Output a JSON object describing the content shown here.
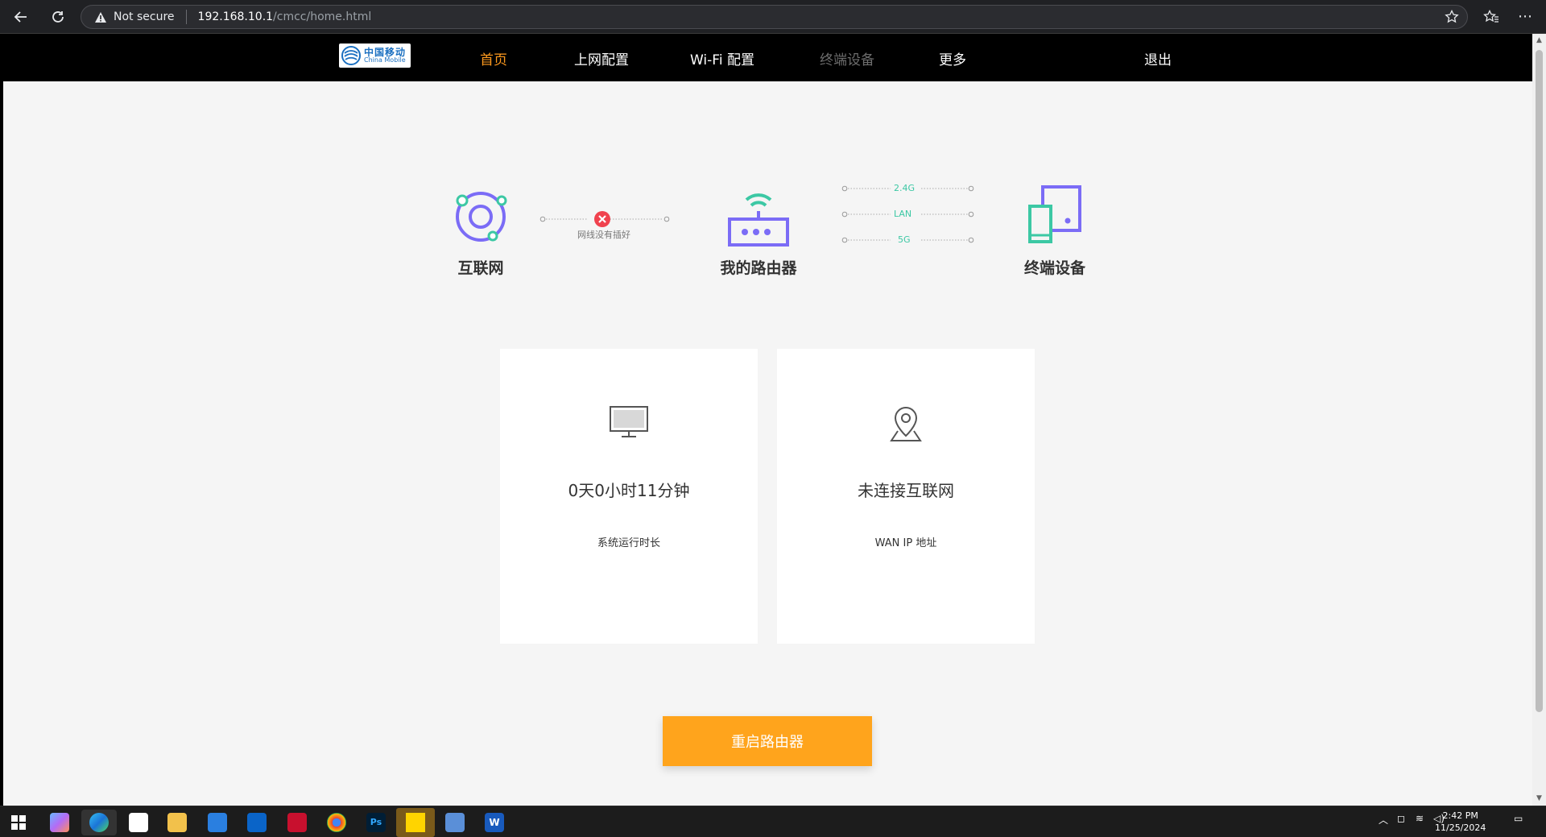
{
  "browser": {
    "security_label": "Not secure",
    "url_host": "192.168.10.1",
    "url_path": "/cmcc/home.html"
  },
  "router": {
    "logo": {
      "cn": "中国移动",
      "en": "China Mobile"
    },
    "nav": [
      {
        "label": "首页",
        "state": "active"
      },
      {
        "label": "上网配置",
        "state": "normal"
      },
      {
        "label": "Wi-Fi 配置",
        "state": "normal"
      },
      {
        "label": "终端设备",
        "state": "disabled"
      },
      {
        "label": "更多",
        "state": "normal"
      }
    ],
    "logout_label": "退出",
    "topology": {
      "internet_label": "互联网",
      "router_label": "我的路由器",
      "devices_label": "终端设备",
      "wan_status": "网线没有插好",
      "bands": [
        "2.4G",
        "LAN",
        "5G"
      ]
    },
    "cards": [
      {
        "icon": "monitor-icon",
        "value": "0天0小时11分钟",
        "caption": "系统运行时长"
      },
      {
        "icon": "location-pin-icon",
        "value": "未连接互联网",
        "caption": "WAN IP 地址"
      }
    ],
    "reboot_label": "重启路由器"
  },
  "taskbar": {
    "time": "2:42 PM",
    "date": "11/25/2024"
  },
  "colors": {
    "accent": "#ffa41c",
    "nav_active": "#ff9a1e",
    "purple": "#7b6cf6",
    "teal": "#3cc8a4",
    "error": "#f0424e"
  }
}
